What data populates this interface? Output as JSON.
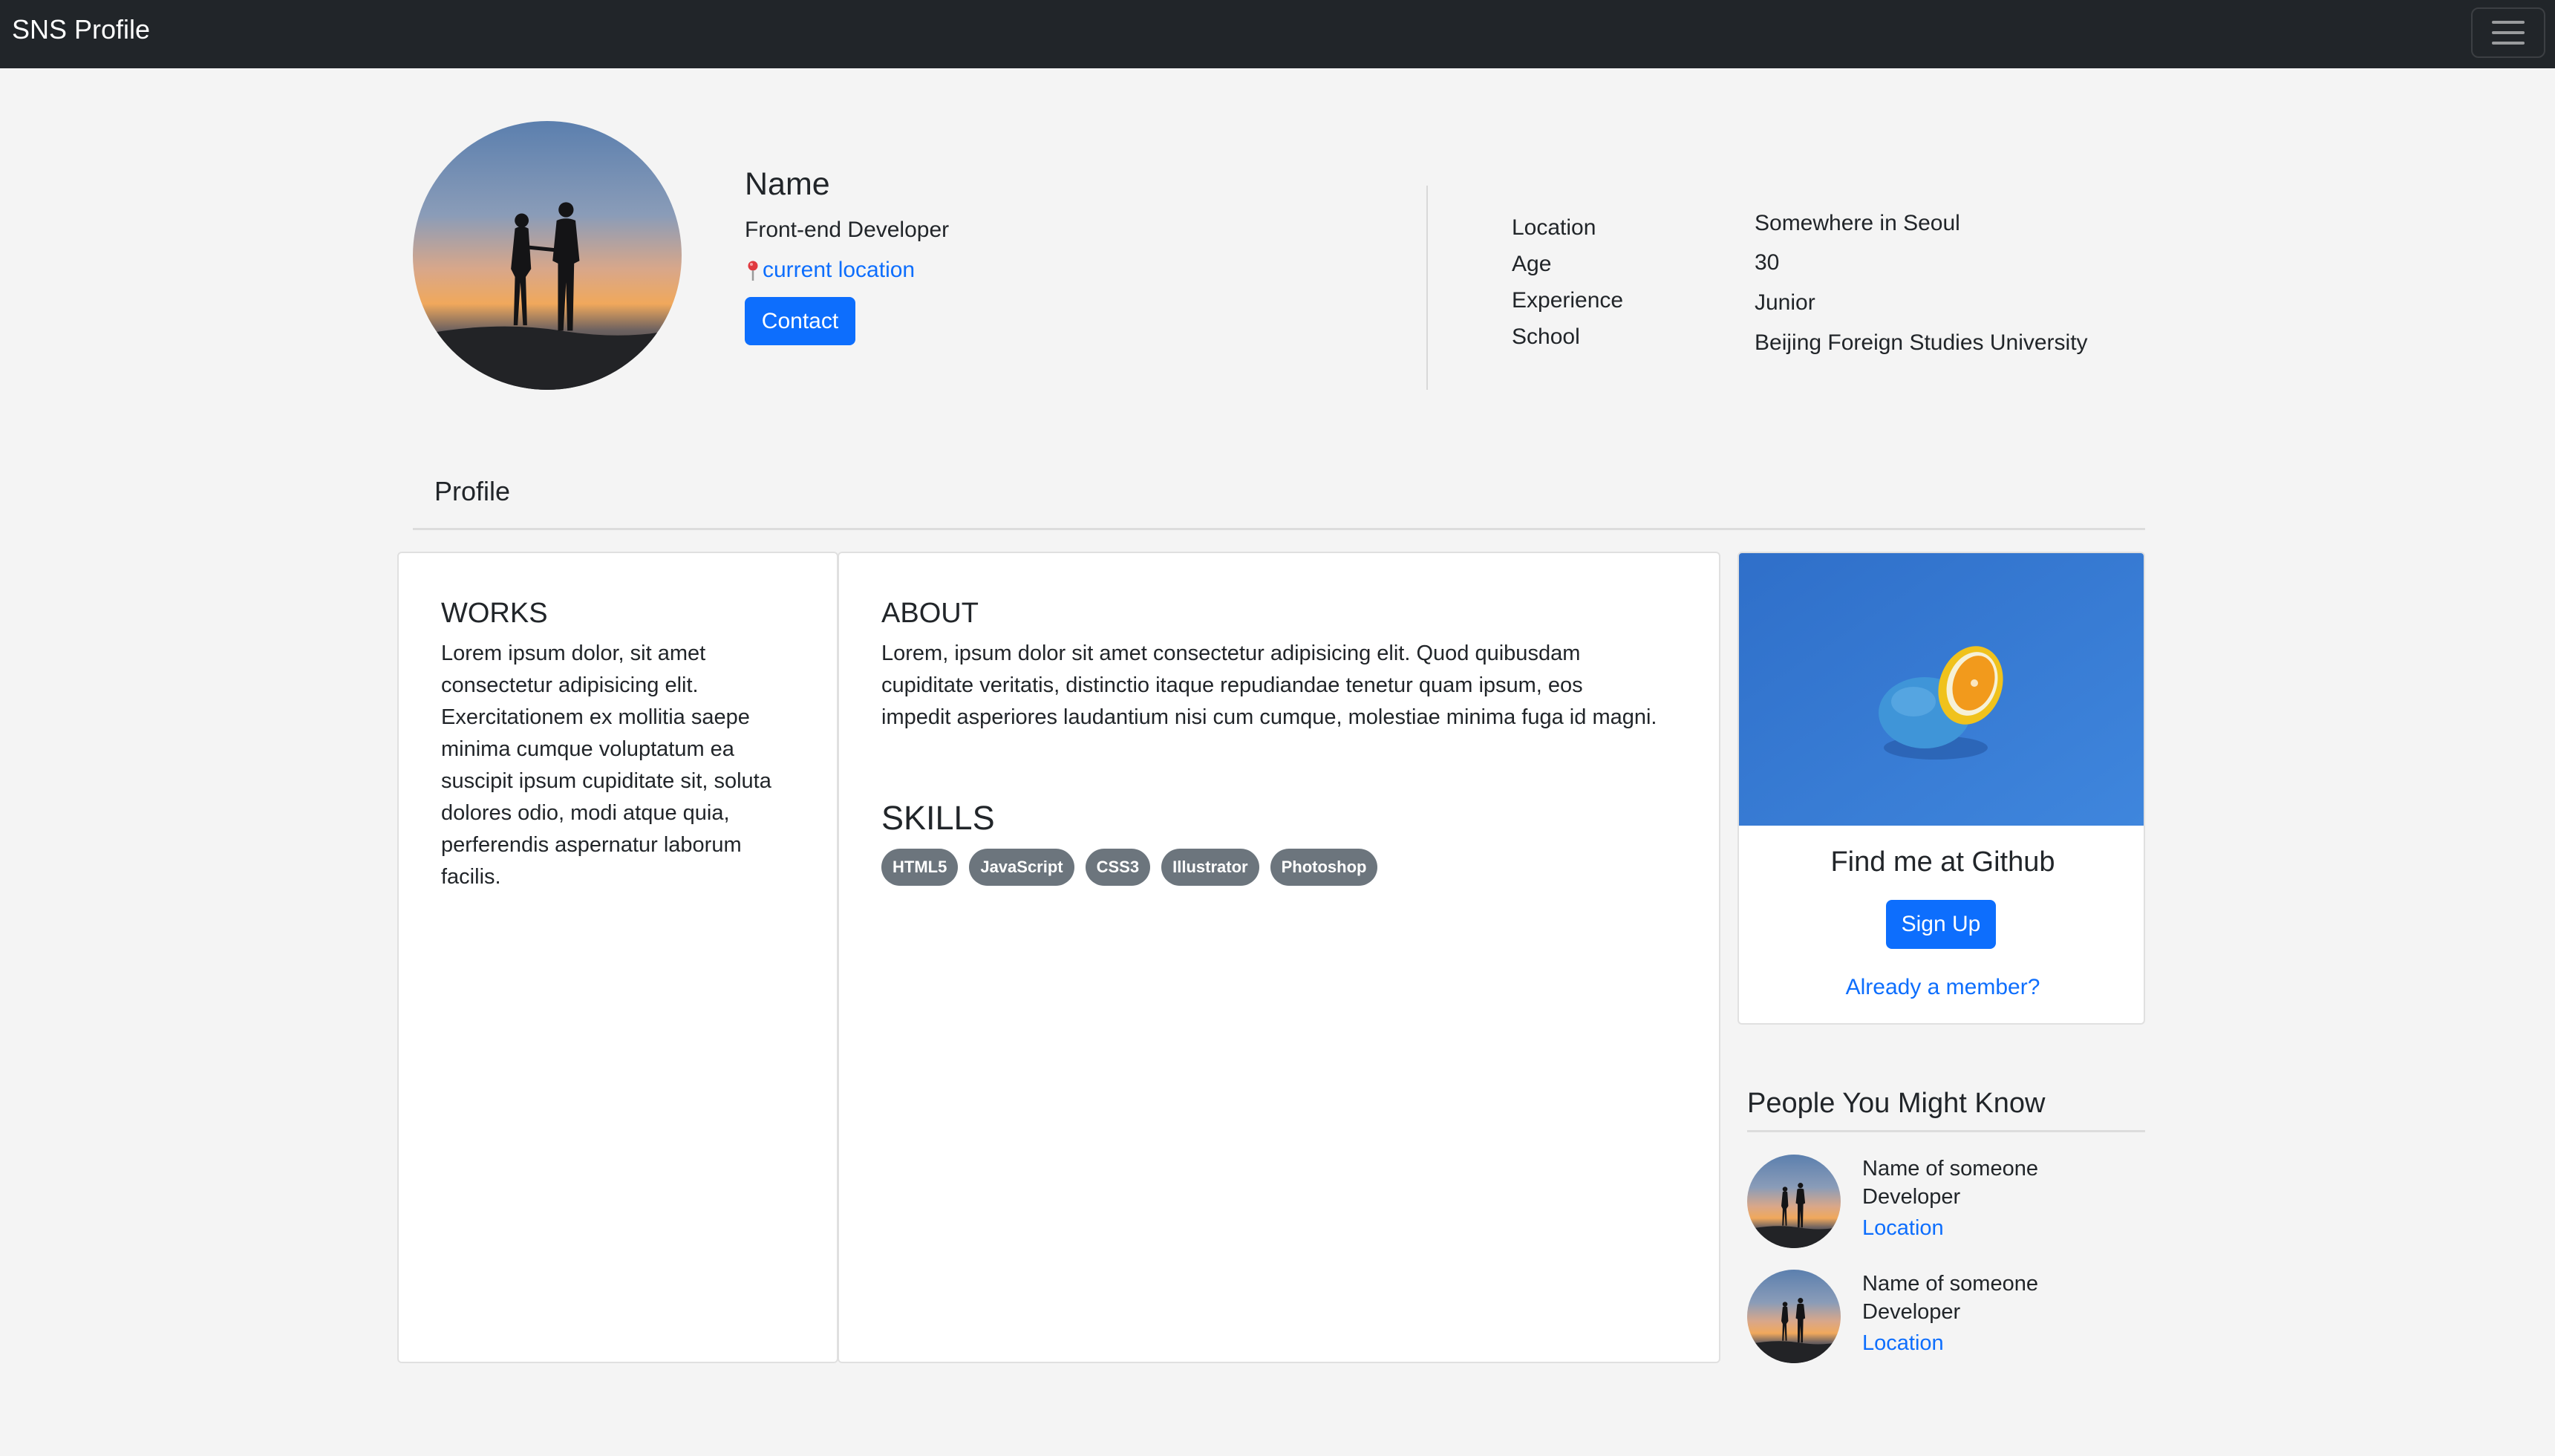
{
  "navbar": {
    "brand": "SNS Profile",
    "toggle_icon": "hamburger-menu-icon"
  },
  "profile": {
    "name": "Name",
    "role": "Front-end Developer",
    "location_link": "current location",
    "contact_label": "Contact",
    "info": [
      {
        "label": "Location",
        "value": "Somewhere in Seoul"
      },
      {
        "label": "Age",
        "value": "30"
      },
      {
        "label": "Experience",
        "value": "Junior"
      },
      {
        "label": "School",
        "value": "Beijing Foreign Studies University"
      }
    ]
  },
  "tab": {
    "label": "Profile"
  },
  "works": {
    "title": "WORKS",
    "lines": [
      "Lorem ipsum dolor, sit amet",
      "consectetur adipisicing elit.",
      "Exercitationem ex mollitia saepe",
      "minima cumque voluptatum ea",
      "suscipit ipsum cupiditate sit, soluta",
      "dolores odio, modi atque quia,",
      "perferendis aspernatur laborum",
      "facilis."
    ]
  },
  "about": {
    "title": "ABOUT",
    "lines": [
      "Lorem, ipsum dolor sit amet consectetur adipisicing elit. Quod quibusdam",
      "cupiditate veritatis, distinctio itaque repudiandae tenetur quam ipsum, eos",
      "impedit asperiores laudantium nisi cum cumque, molestiae minima fuga id magni."
    ]
  },
  "skills": {
    "title": "SKILLS",
    "items": [
      "HTML5",
      "JavaScript",
      "CSS3",
      "Illustrator",
      "Photoshop"
    ]
  },
  "github_card": {
    "title": "Find me at Github",
    "signup_label": "Sign Up",
    "member_link": "Already a member?"
  },
  "people": {
    "title": "People You Might Know",
    "items": [
      {
        "name": "Name of someone",
        "role": "Developer",
        "location": "Location"
      },
      {
        "name": "Name of someone",
        "role": "Developer",
        "location": "Location"
      }
    ]
  },
  "colors": {
    "navbar": "#212529",
    "primary": "#0d6efd",
    "badge": "#6c757d",
    "background": "#f4f4f4"
  }
}
